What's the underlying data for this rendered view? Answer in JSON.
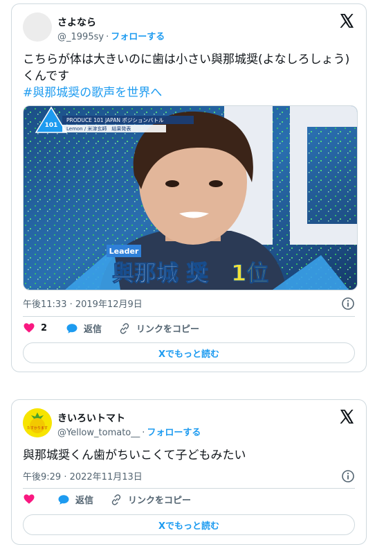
{
  "tweets": [
    {
      "display_name": "さよなら",
      "handle": "@_1995sy",
      "follow_label": "フォローする",
      "text": "こちらが体は大きいのに歯は小さい與那城奨(よなしろしょう)くんです",
      "hashtag": "#與那城奨の歌声を世界へ",
      "media": {
        "badge_top": "PRODUCE 101 JAPAN ポジションバトル",
        "badge_sub": "Lemon / 米津玄師　結果発表",
        "logo_text": "101",
        "tag": "Leader",
        "caption_name": "與那城 奨",
        "caption_rank": "1位"
      },
      "timestamp": "午後11:33 · 2019年12月9日",
      "likes": "2",
      "reply_label": "返信",
      "copy_link_label": "リンクをコピー",
      "read_more_label": "Xでもっと読む"
    },
    {
      "display_name": "きいろいトマト",
      "handle": "@Yellow_tomato__",
      "follow_label": "フォローする",
      "avatar_text": "たすかります",
      "text": "與那城奨くん歯がちいこくて子どもみたい",
      "timestamp": "午後9:29 · 2022年11月13日",
      "reply_label": "返信",
      "copy_link_label": "リンクをコピー",
      "read_more_label": "Xでもっと読む"
    }
  ],
  "colors": {
    "accent": "#1d9bf0",
    "like": "#f91880",
    "muted": "#536471",
    "border": "#cfd9de"
  },
  "icons": [
    "x-logo-icon",
    "heart-icon",
    "reply-bubble-icon",
    "link-icon",
    "info-icon"
  ]
}
